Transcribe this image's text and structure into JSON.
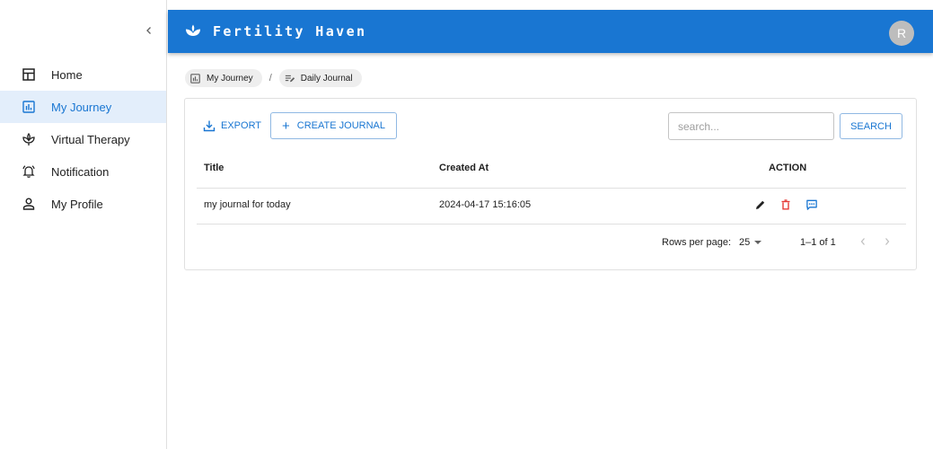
{
  "app": {
    "title": "Fertility Haven",
    "avatar_initial": "R",
    "colors": {
      "primary": "#1976d2",
      "danger": "#e53935",
      "active_bg": "#e3eefb"
    }
  },
  "sidebar": {
    "collapse_icon": "chevron-left-icon",
    "items": [
      {
        "label": "Home",
        "icon": "grid-icon",
        "active": false
      },
      {
        "label": "My Journey",
        "icon": "bar-chart-icon",
        "active": true
      },
      {
        "label": "Virtual Therapy",
        "icon": "lotus-icon",
        "active": false
      },
      {
        "label": "Notification",
        "icon": "bell-icon",
        "active": false
      },
      {
        "label": "My Profile",
        "icon": "person-icon",
        "active": false
      }
    ]
  },
  "breadcrumb": [
    {
      "label": "My Journey",
      "icon": "bar-chart-icon"
    },
    {
      "label": "Daily Journal",
      "icon": "edit-list-icon"
    }
  ],
  "breadcrumb_separator": "/",
  "toolbar": {
    "export_label": "EXPORT",
    "create_label": "CREATE JOURNAL",
    "create_plus": "+",
    "search_placeholder": "search...",
    "search_value": "",
    "search_label": "SEARCH"
  },
  "table": {
    "columns": [
      "Title",
      "Created At",
      "ACTION"
    ],
    "rows": [
      {
        "title": "my journal for today",
        "created_at": "2024-04-17 15:16:05",
        "actions": [
          "edit-icon",
          "delete-icon",
          "comment-icon"
        ]
      }
    ]
  },
  "pagination": {
    "rows_per_page_label": "Rows per page:",
    "rows_per_page": "25",
    "range": "1–1 of 1"
  }
}
